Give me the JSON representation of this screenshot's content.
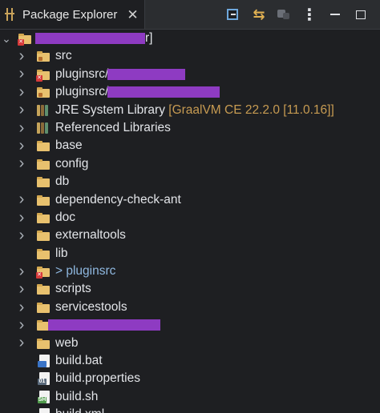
{
  "view": {
    "title": "Package Explorer",
    "close_glyph": "✕",
    "toolbar": {
      "collapse_all": "collapse-all-icon",
      "link_with_editor": "link-with-editor-icon",
      "focus": "focus-on-active-icon",
      "menu": "view-menu-icon",
      "minimize": "minimize-icon",
      "maximize": "maximize-icon"
    }
  },
  "tree": {
    "project": {
      "label_suffix": "r]",
      "expanded": true
    },
    "items": [
      {
        "label": "src",
        "kind": "package-folder",
        "expanded": false
      },
      {
        "label": "pluginsrc/",
        "kind": "package-folder-error",
        "expanded": false
      },
      {
        "label": "pluginsrc/",
        "kind": "package-folder",
        "expanded": false
      },
      {
        "label": "JRE System Library",
        "decoration": "[GraalVM CE 22.2.0 [11.0.16]]",
        "kind": "library",
        "expanded": false
      },
      {
        "label": "Referenced Libraries",
        "kind": "library",
        "expanded": false
      },
      {
        "label": "base",
        "kind": "folder",
        "expanded": false
      },
      {
        "label": "config",
        "kind": "folder",
        "expanded": false
      },
      {
        "label": "db",
        "kind": "folder",
        "expanded": null
      },
      {
        "label": "dependency-check-ant",
        "kind": "folder",
        "expanded": false
      },
      {
        "label": "doc",
        "kind": "folder",
        "expanded": false
      },
      {
        "label": "externaltools",
        "kind": "folder",
        "expanded": false
      },
      {
        "label": "lib",
        "kind": "folder",
        "expanded": null
      },
      {
        "label": "> pluginsrc",
        "kind": "folder-error",
        "expanded": false
      },
      {
        "label": "scripts",
        "kind": "folder",
        "expanded": false
      },
      {
        "label": "servicestools",
        "kind": "folder",
        "expanded": false
      },
      {
        "label": "",
        "kind": "folder",
        "expanded": false
      },
      {
        "label": "web",
        "kind": "folder",
        "expanded": false
      },
      {
        "label": "build.bat",
        "kind": "file-bat",
        "expanded": null
      },
      {
        "label": "build.properties",
        "kind": "file-properties",
        "expanded": null
      },
      {
        "label": "build.sh",
        "kind": "file-sh",
        "expanded": null
      },
      {
        "label": "build.xml",
        "kind": "file-xml",
        "expanded": null
      }
    ]
  },
  "colors": {
    "background": "#1e1f22",
    "folder": "#e8c16e",
    "error": "#d63a3a",
    "decoration": "#c79b52",
    "redaction": "#8e3bc2"
  }
}
